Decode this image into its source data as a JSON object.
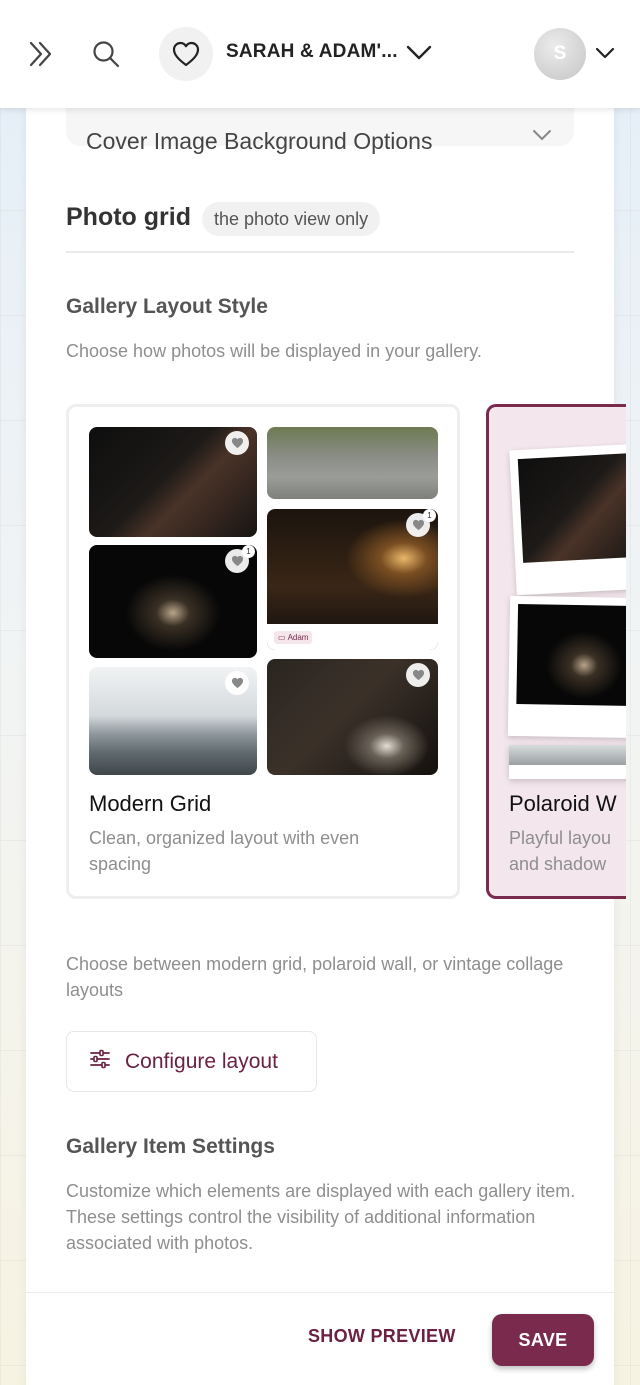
{
  "header": {
    "event_name": "SARAH & ADAM'...",
    "avatar_initial": "S",
    "icons": [
      "double-chevron-right-icon",
      "search-icon",
      "heart-icon",
      "chevron-down-icon",
      "chevron-down-icon"
    ]
  },
  "cover_options": {
    "label": "Cover Image Background Options"
  },
  "photo_grid": {
    "title": "Photo grid",
    "scope_badge": "the photo view only"
  },
  "gallery_layout": {
    "heading": "Gallery Layout Style",
    "description": "Choose how photos will be displayed in your gallery.",
    "options": [
      {
        "title": "Modern Grid",
        "description": "Clean, organized layout with even spacing",
        "selected": false,
        "tag_label": "Adam",
        "like_counts": [
          "1",
          "1"
        ]
      },
      {
        "title": "Polaroid W",
        "description": "Playful layou and shadow",
        "selected": true
      }
    ],
    "help_text": "Choose between modern grid, polaroid wall, or vintage collage layouts",
    "configure_label": "Configure layout"
  },
  "gallery_item_settings": {
    "heading": "Gallery Item Settings",
    "description": "Customize which elements are displayed with each gallery item. These settings control the visibility of additional information associated with photos."
  },
  "footer": {
    "preview_label": "SHOW PREVIEW",
    "save_label": "SAVE"
  },
  "colors": {
    "accent": "#7a2a4d",
    "accent_text": "#6b2142",
    "muted_text": "#8e8e8e"
  }
}
